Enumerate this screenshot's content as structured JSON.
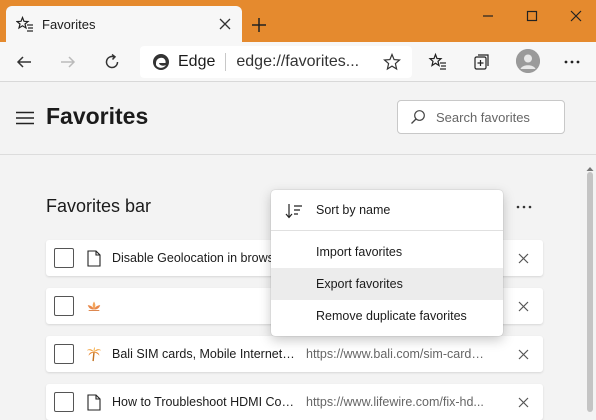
{
  "browser": {
    "tab_title": "Favorites",
    "tab_icon": "favorites-star-icon",
    "address_site": "Edge",
    "address_url": "edge://favorites...",
    "accent_color": "#e58a2e"
  },
  "page": {
    "title": "Favorites",
    "search_placeholder": "Search favorites",
    "section_title": "Favorites bar"
  },
  "favorites": [
    {
      "title": "Disable Geolocation in brows",
      "url": "",
      "icon": "document-icon"
    },
    {
      "title": "",
      "url": "",
      "icon": "lotus-icon"
    },
    {
      "title": "Bali SIM cards, Mobile Internet, R...",
      "url": "https://www.bali.com/sim-cards-...",
      "icon": "palm-tree-icon"
    },
    {
      "title": "How to Troubleshoot HDMI Conn...",
      "url": "https://www.lifewire.com/fix-hd...",
      "icon": "document-icon"
    }
  ],
  "menu": {
    "items": [
      {
        "label": "Sort by name"
      },
      {
        "label": "Import favorites"
      },
      {
        "label": "Export favorites"
      },
      {
        "label": "Remove duplicate favorites"
      }
    ],
    "hovered": "Export favorites"
  }
}
